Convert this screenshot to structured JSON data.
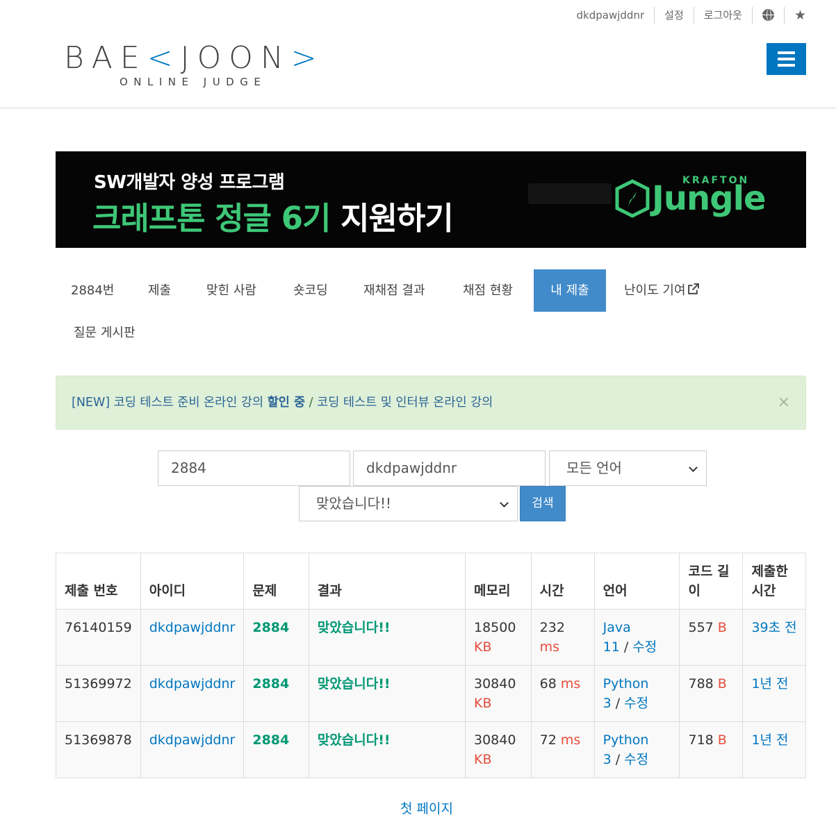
{
  "topbar": {
    "username": "dkdpawjddnr",
    "settings": "설정",
    "logout": "로그아웃",
    "language_icon": "globe-icon",
    "favorite_icon": "star-icon"
  },
  "logo": {
    "left": "BAE",
    "bracket_open": "<",
    "middle": "JOON",
    "bracket_close": ">",
    "subtitle": "ONLINE JUDGE"
  },
  "banner": {
    "line1": "SW개발자 양성 프로그램",
    "line2_green": "크래프톤 정글 6기 ",
    "line2_white": "지원하기",
    "brand_small": "KRAFTON",
    "brand_large": "Jungle"
  },
  "tabs": [
    {
      "label": "2884번",
      "active": false
    },
    {
      "label": "제출",
      "active": false
    },
    {
      "label": "맞힌 사람",
      "active": false
    },
    {
      "label": "숏코딩",
      "active": false
    },
    {
      "label": "재채점 결과",
      "active": false
    },
    {
      "label": "채점 현황",
      "active": false
    },
    {
      "label": "내 제출",
      "active": true
    },
    {
      "label": "난이도 기여",
      "active": false
    },
    {
      "label": "질문 게시판",
      "active": false
    }
  ],
  "alert": {
    "prefix": "[NEW] 코딩 테스트 준비 온라인 강의 ",
    "bold": "할인 중",
    "separator": " / ",
    "link2": "코딩 테스트 및 인터뷰 온라인 강의",
    "close": "×"
  },
  "search": {
    "problem_id": "2884",
    "user_id": "dkdpawjddnr",
    "language": "모든 언어",
    "result": "맞았습니다!!",
    "button": "검색"
  },
  "table": {
    "headers": {
      "id": "제출 번호",
      "user": "아이디",
      "problem": "문제",
      "result": "결과",
      "memory": "메모리",
      "time": "시간",
      "language": "언어",
      "code_len_1": "코드 길",
      "code_len_2": "이",
      "submitted_1": "제출한",
      "submitted_2": "시간"
    },
    "rows": [
      {
        "id": "76140159",
        "user": "dkdpawjddnr",
        "problem": "2884",
        "result": "맞았습니다!!",
        "memory": "18500",
        "memory_unit": "KB",
        "time": "232",
        "time_unit": "ms",
        "lang_a": "Java",
        "lang_b": "11",
        "slash": " / ",
        "edit": "수정",
        "code_len": "557",
        "code_unit": "B",
        "submitted": "39초 전"
      },
      {
        "id": "51369972",
        "user": "dkdpawjddnr",
        "problem": "2884",
        "result": "맞았습니다!!",
        "memory": "30840",
        "memory_unit": "KB",
        "time": "68",
        "time_unit": "ms",
        "lang_a": "Python",
        "lang_b": "3",
        "slash": " / ",
        "edit": "수정",
        "code_len": "788",
        "code_unit": "B",
        "submitted": "1년 전"
      },
      {
        "id": "51369878",
        "user": "dkdpawjddnr",
        "problem": "2884",
        "result": "맞았습니다!!",
        "memory": "30840",
        "memory_unit": "KB",
        "time": "72",
        "time_unit": "ms",
        "lang_a": "Python",
        "lang_b": "3",
        "slash": " / ",
        "edit": "수정",
        "code_len": "718",
        "code_unit": "B",
        "submitted": "1년 전"
      }
    ]
  },
  "pager": {
    "first_page": "첫 페이지"
  }
}
